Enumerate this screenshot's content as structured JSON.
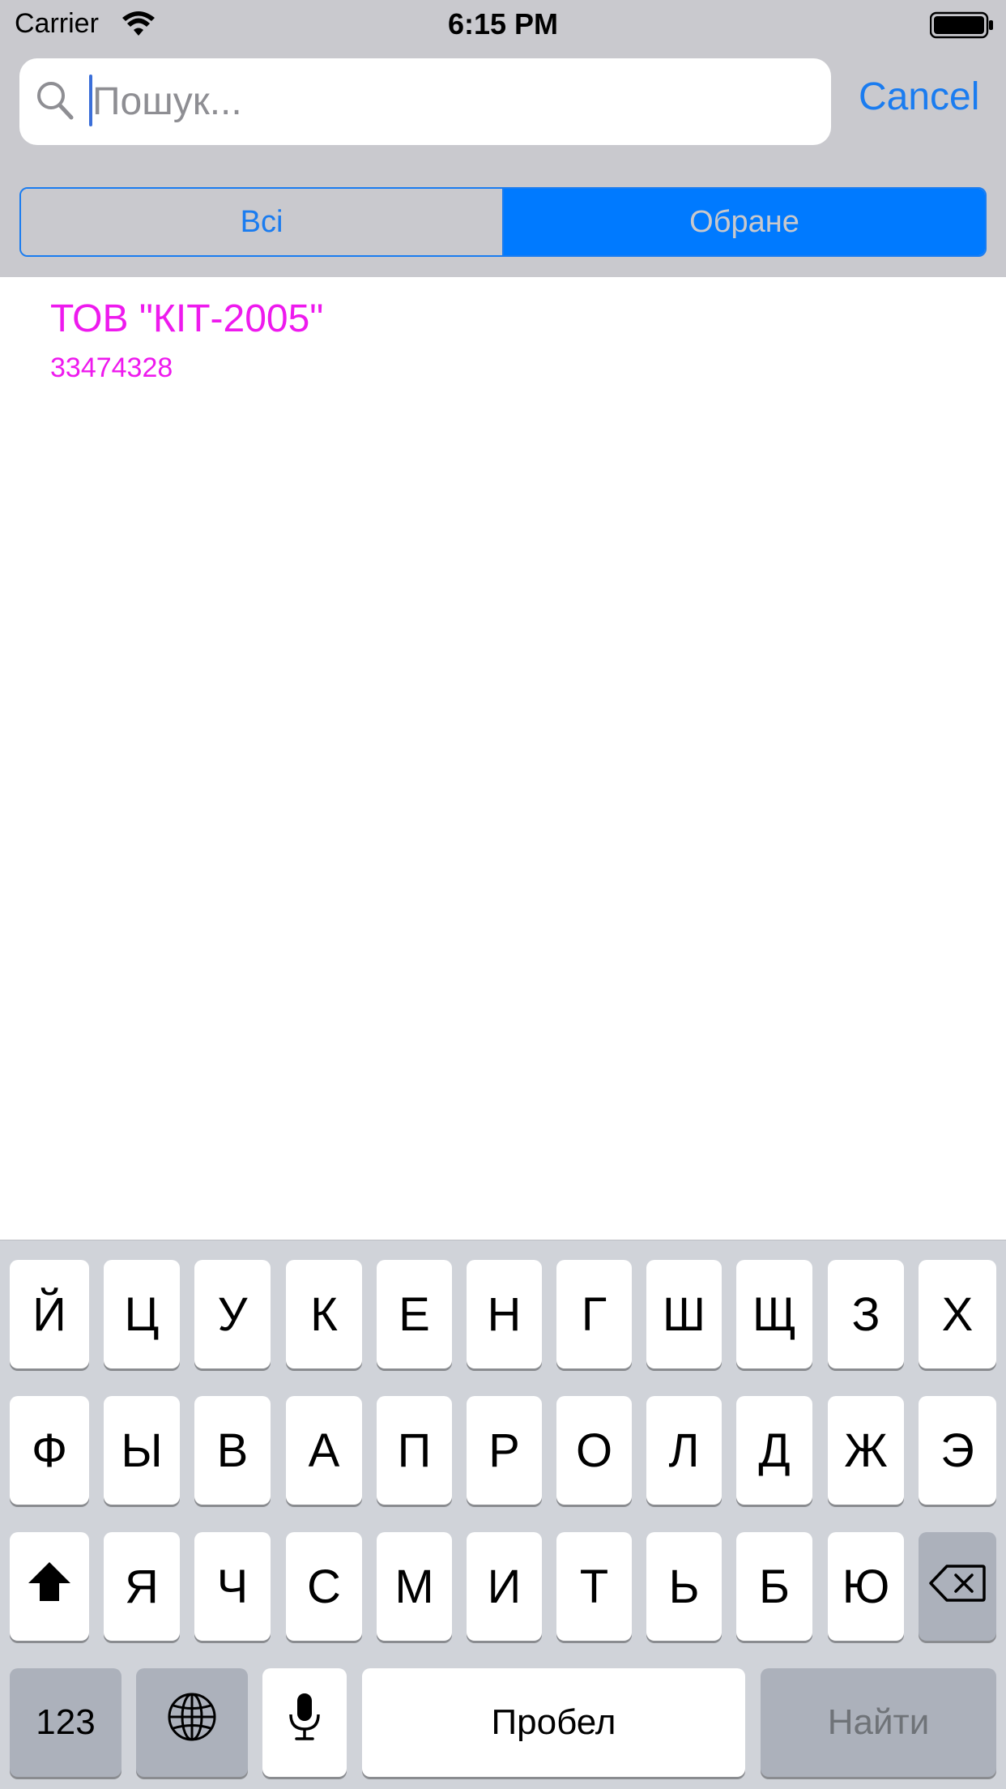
{
  "status_bar": {
    "carrier": "Carrier",
    "time": "6:15 PM",
    "wifi_icon": "wifi-icon",
    "battery_icon": "battery-icon"
  },
  "search": {
    "placeholder": "Пошук...",
    "value": "",
    "cancel_label": "Cancel",
    "icon": "search-icon"
  },
  "segments": {
    "all": "Всі",
    "favorites": "Обране",
    "selected": "favorites"
  },
  "results": [
    {
      "title": "ТОВ \"КІТ-2005\"",
      "code": "33474328"
    }
  ],
  "colors": {
    "accent": "#1a7cf0",
    "segment_selected": "#007aff",
    "item_text": "#ee1aee",
    "header_bg": "#c9c9ce",
    "keyboard_bg": "#d0d3d9"
  },
  "keyboard": {
    "row1": [
      "Й",
      "Ц",
      "У",
      "К",
      "Е",
      "Н",
      "Г",
      "Ш",
      "Щ",
      "З",
      "Х"
    ],
    "row2": [
      "Ф",
      "Ы",
      "В",
      "А",
      "П",
      "Р",
      "О",
      "Л",
      "Д",
      "Ж",
      "Э"
    ],
    "row3": [
      "Я",
      "Ч",
      "С",
      "М",
      "И",
      "Т",
      "Ь",
      "Б",
      "Ю"
    ],
    "numbers_label": "123",
    "space_label": "Пробел",
    "search_label": "Найти",
    "shift_icon": "shift-icon",
    "delete_icon": "delete-icon",
    "globe_icon": "globe-icon",
    "mic_icon": "microphone-icon"
  }
}
